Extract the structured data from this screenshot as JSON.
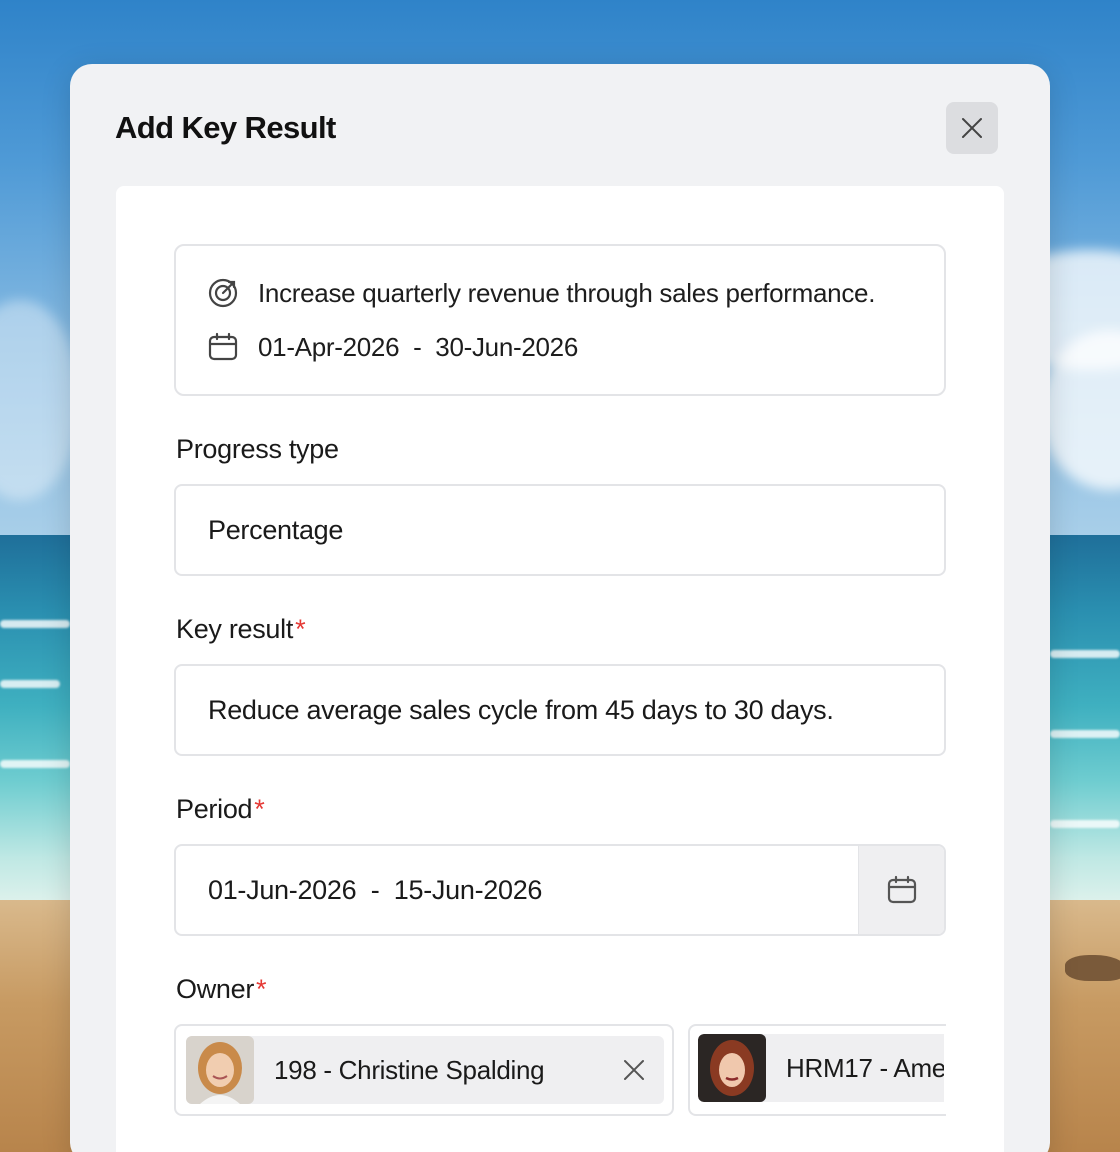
{
  "modal": {
    "title": "Add Key Result"
  },
  "objective": {
    "name": "Increase quarterly revenue through sales performance.",
    "date_range": "01-Apr-2026  -  30-Jun-2026"
  },
  "progress_type": {
    "label": "Progress type",
    "value": "Percentage"
  },
  "key_result": {
    "label": "Key result",
    "required_mark": "*",
    "value": "Reduce average sales cycle from 45 days to 30 days."
  },
  "period": {
    "label": "Period",
    "required_mark": "*",
    "value": "01-Jun-2026  -  15-Jun-2026"
  },
  "owner": {
    "label": "Owner",
    "required_mark": "*",
    "owners": [
      {
        "name": "198 - Christine Spalding"
      },
      {
        "name": "HRM17 - Ame"
      }
    ]
  },
  "icons": {
    "close": "close-icon",
    "objective": "target-icon",
    "date": "calendar-icon",
    "remove_owner": "remove-icon"
  },
  "colors": {
    "required": "#e53935",
    "modal_bg": "#f1f2f4",
    "panel_bg": "#ffffff",
    "border": "#e3e4e7"
  }
}
